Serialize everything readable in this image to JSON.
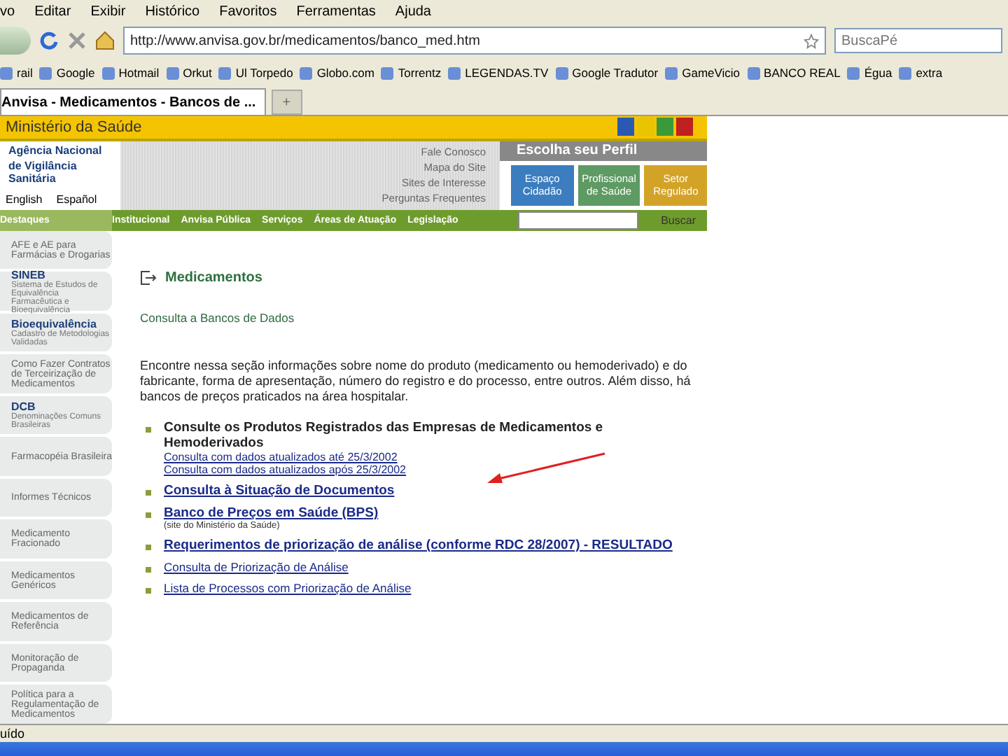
{
  "menu": [
    "vo",
    "Editar",
    "Exibir",
    "Histórico",
    "Favoritos",
    "Ferramentas",
    "Ajuda"
  ],
  "address": {
    "value": "http://www.anvisa.gov.br/medicamentos/banco_med.htm"
  },
  "search": {
    "placeholder": "BuscaPé"
  },
  "bookmarks": [
    "rail",
    "Google",
    "Hotmail",
    "Orkut",
    "Ul Torpedo",
    "Globo.com",
    "Torrentz",
    "LEGENDAS.TV",
    "Google Tradutor",
    "GameVicio",
    "BANCO REAL",
    "Égua",
    "extra"
  ],
  "tabs": [
    {
      "label": "Anvisa - Medicamentos - Bancos de ...",
      "selected": true
    }
  ],
  "new_tab": "+",
  "site": {
    "header": "Ministério da Saúde",
    "agency": [
      "Agência Nacional",
      "de Vigilância Sanitária"
    ],
    "languages": [
      "English",
      "Español"
    ],
    "quick_links": [
      "Fale Conosco",
      "Mapa do Site",
      "Sites de Interesse",
      "Perguntas Frequentes"
    ],
    "profile_title": "Escolha seu Perfil",
    "profiles": [
      {
        "label": "Espaço Cidadão",
        "color": "#3b7dbf"
      },
      {
        "label": "Profissional de Saúde",
        "color": "#5e9a63"
      },
      {
        "label": "Setor Regulado",
        "color": "#d3a328"
      }
    ],
    "nav_title": "Destaques",
    "nav": [
      "Institucional",
      "Anvisa Pública",
      "Serviços",
      "Áreas de Atuação",
      "Legislação"
    ],
    "search_button": "Buscar"
  },
  "sidebar": [
    {
      "kind": "plain",
      "title": "AFE e AE para Farmácias e Drogarias"
    },
    {
      "kind": "heading",
      "title": "SINEB",
      "subtitle": "Sistema de Estudos de Equivalência Farmacêutica e Bioequivalência"
    },
    {
      "kind": "heading",
      "title": "Bioequivalência",
      "subtitle": "Cadastro de Metodologias Validadas"
    },
    {
      "kind": "plain",
      "title": "Como Fazer Contratos de Terceirização de Medicamentos"
    },
    {
      "kind": "heading",
      "title": "DCB",
      "subtitle": "Denominações Comuns Brasileiras"
    },
    {
      "kind": "plain",
      "title": "Farmacopéia Brasileira"
    },
    {
      "kind": "plain",
      "title": "Informes Técnicos"
    },
    {
      "kind": "plain",
      "title": "Medicamento Fracionado"
    },
    {
      "kind": "plain",
      "title": "Medicamentos Genéricos"
    },
    {
      "kind": "plain",
      "title": "Medicamentos de Referência"
    },
    {
      "kind": "plain",
      "title": "Monitoração de Propaganda"
    },
    {
      "kind": "plain",
      "title": "Política para a Regulamentação de Medicamentos"
    }
  ],
  "content": {
    "title": "Medicamentos",
    "subtitle": "Consulta a Bancos de Dados",
    "intro": "Encontre nessa seção informações sobre nome do produto (medicamento ou hemoderivado) e do fabricante, forma de apresentação, número do registro e do processo, entre outros. Além disso, há bancos de preços praticados na área hospitalar.",
    "items": [
      {
        "kind": "heading",
        "title": "Consulte os Produtos Registrados das Empresas de Medicamentos e Hemoderivados",
        "links": [
          "Consulta com dados atualizados até 25/3/2002",
          "Consulta com dados atualizados após 25/3/2002"
        ]
      },
      {
        "kind": "link",
        "title": "Consulta à Situação de Documentos"
      },
      {
        "kind": "link",
        "title": "Banco de Preços em Saúde (BPS)",
        "note": "(site do Ministério da Saúde)"
      },
      {
        "kind": "link",
        "title": "Requerimentos de priorização de análise (conforme RDC 28/2007) - RESULTADO"
      },
      {
        "kind": "small",
        "title": "Consulta de Priorização de Análise"
      },
      {
        "kind": "small",
        "title": "Lista de Processos com Priorização de Análise"
      }
    ]
  },
  "status": "uído"
}
